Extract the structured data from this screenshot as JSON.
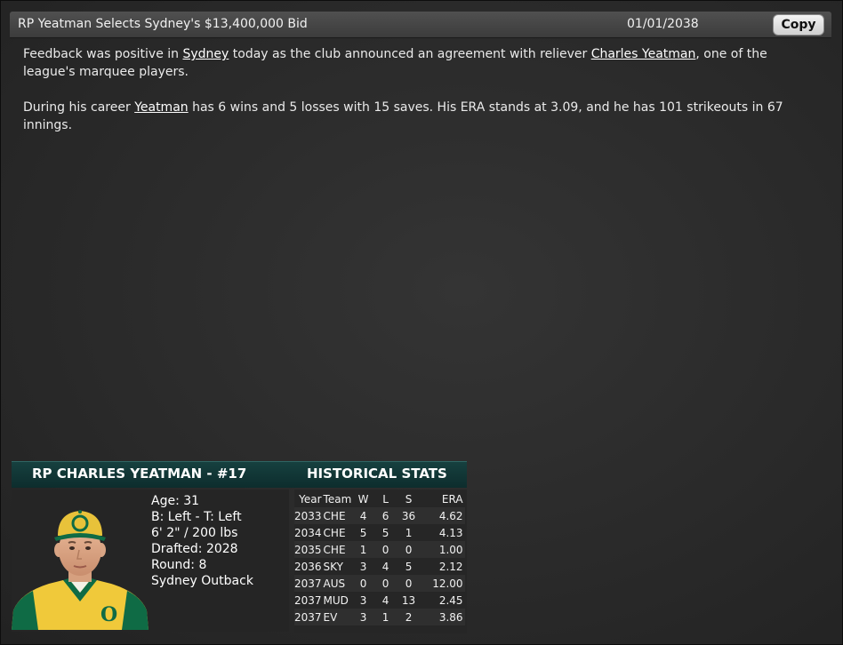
{
  "header": {
    "headline": "RP Yeatman Selects Sydney's $13,400,000 Bid",
    "date": "01/01/2038",
    "copy_label": "Copy"
  },
  "article": {
    "p1": {
      "t1": "Feedback was positive in ",
      "link_city": "Sydney",
      "t2": " today as the club announced an agreement with reliever ",
      "link_player": "Charles Yeatman",
      "t3": ", one of the league's marquee players."
    },
    "p2": {
      "t1": "During his career ",
      "link_player": "Yeatman",
      "t2": " has 6 wins and 5 losses with 15 saves. His ERA stands at 3.09, and he has 101 strikeouts in 67 innings."
    }
  },
  "player_card": {
    "name_header": "RP CHARLES YEATMAN - #17",
    "stats_header": "HISTORICAL STATS",
    "bio": {
      "age": "Age: 31",
      "bats_throws": "B: Left - T: Left",
      "height_weight": "6' 2\" / 200 lbs",
      "drafted": "Drafted: 2028",
      "round": "Round: 8",
      "team": "Sydney Outback"
    },
    "portrait_icon": "player-portrait-icon",
    "colors": {
      "cap": "#e8c23a",
      "jersey": "#f0c93a",
      "trim": "#0f6b45",
      "header_bg": "#0d2d2d"
    },
    "stats": {
      "columns": [
        "Year",
        "Team",
        "W",
        "L",
        "S",
        "ERA"
      ],
      "rows": [
        [
          "2033",
          "CHE",
          "4",
          "6",
          "36",
          "4.62"
        ],
        [
          "2034",
          "CHE",
          "5",
          "5",
          "1",
          "4.13"
        ],
        [
          "2035",
          "CHE",
          "1",
          "0",
          "0",
          "1.00"
        ],
        [
          "2036",
          "SKY",
          "3",
          "4",
          "5",
          "2.12"
        ],
        [
          "2037",
          "AUS",
          "0",
          "0",
          "0",
          "12.00"
        ],
        [
          "2037",
          "MUD",
          "3",
          "4",
          "13",
          "2.45"
        ],
        [
          "2037",
          "EV",
          "3",
          "1",
          "2",
          "3.86"
        ]
      ]
    }
  }
}
